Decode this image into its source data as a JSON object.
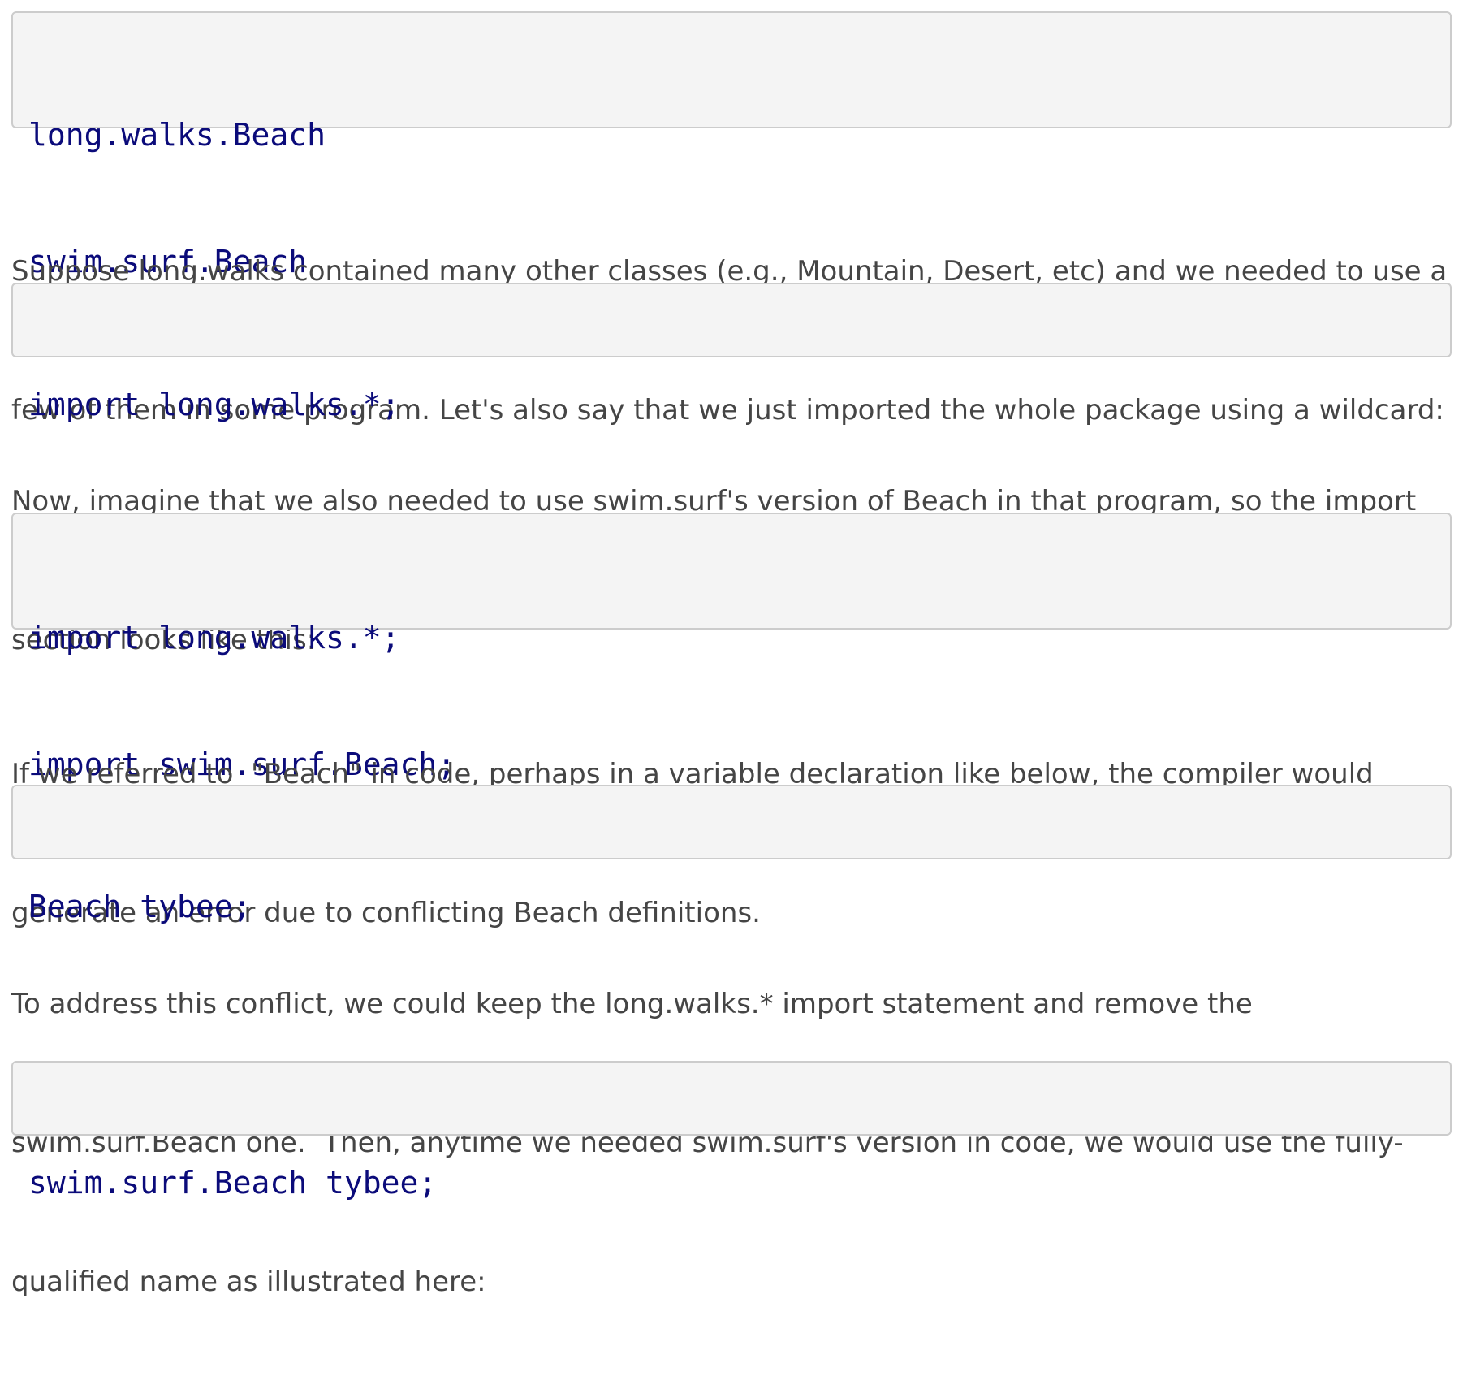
{
  "blocks": {
    "code1": [
      "long.walks.Beach",
      "swim.surf.Beach"
    ],
    "para1": [
      "Suppose long.walks contained many other classes (e.g., Mountain, Desert, etc) and we needed to use a",
      "few of them in some program. Let's also say that we just imported the whole package using a wildcard:"
    ],
    "code2": [
      "import long.walks.*;"
    ],
    "para2": [
      "Now, imagine that we also needed to use swim.surf's version of Beach in that program, so the import",
      "section looks like this:"
    ],
    "code3": [
      "import long.walks.*;",
      "import swim.surf.Beach;"
    ],
    "para3": [
      "If we referred to  \"Beach\" in code, perhaps in a variable declaration like below, the compiler would",
      "generate an error due to conflicting Beach definitions."
    ],
    "code4": [
      "Beach tybee;"
    ],
    "para4": [
      "To address this conflict, we could keep the long.walks.* import statement and remove the",
      "swim.surf.Beach one.  Then, anytime we needed swim.surf's version in code, we would use the fully-",
      "qualified name as illustrated here:"
    ],
    "code5": [
      "swim.surf.Beach tybee;"
    ]
  },
  "colors": {
    "code_text": "#0b0b7a",
    "code_bg": "#f4f4f4",
    "code_border": "#cccccc",
    "body_text": "#454545"
  }
}
